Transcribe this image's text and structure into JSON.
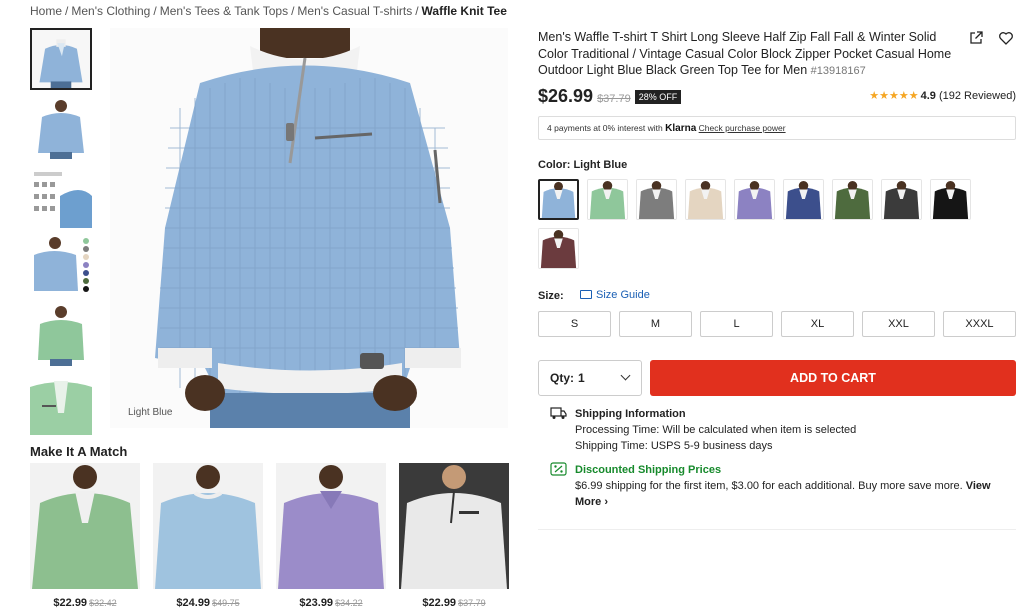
{
  "breadcrumb": {
    "items": [
      "Home",
      "Men's Clothing",
      "Men's Tees & Tank Tops",
      "Men's Casual T-shirts"
    ],
    "current": "Waffle Knit Tee"
  },
  "gallery": {
    "caption": "Light Blue",
    "thumbnails": [
      "light-blue-front",
      "light-blue-back",
      "waffle-detail-chart",
      "light-blue-color-options",
      "green-front",
      "green-closeup"
    ]
  },
  "match": {
    "title": "Make It A Match",
    "items": [
      {
        "price": "$22.99",
        "was": "$32.42",
        "color": "#8dbf8f"
      },
      {
        "price": "$24.99",
        "was": "$49.75",
        "color": "#9fc3df"
      },
      {
        "price": "$23.99",
        "was": "$34.22",
        "color": "#9b8cc9"
      },
      {
        "price": "$22.99",
        "was": "$37.79",
        "color": "#e9e9e9"
      }
    ]
  },
  "product": {
    "title": "Men's Waffle T-shirt T Shirt Long Sleeve Half Zip Fall Fall & Winter Solid Color Traditional / Vintage Casual Color Block Zipper Pocket Casual Home Outdoor Light Blue Black Green Top Tee for Men",
    "sku": "#13918167",
    "price": "$26.99",
    "was_price": "$37.79",
    "discount": "28% OFF",
    "stars": "★★★★★",
    "rating": "4.9",
    "reviews": "(192 Reviewed)"
  },
  "klarna": {
    "text": "4 payments at 0% interest with",
    "brand": "Klarna",
    "link": "Check purchase power"
  },
  "color": {
    "label": "Color: Light Blue",
    "swatches": [
      {
        "name": "Light Blue",
        "hex": "#8fb3d9"
      },
      {
        "name": "Green",
        "hex": "#8fc79b"
      },
      {
        "name": "Gray",
        "hex": "#7d7d7d"
      },
      {
        "name": "Beige",
        "hex": "#e4d5c1"
      },
      {
        "name": "Purple",
        "hex": "#8c82c2"
      },
      {
        "name": "Navy",
        "hex": "#3c4f8c"
      },
      {
        "name": "Army Green",
        "hex": "#4e6b3e"
      },
      {
        "name": "Dark Gray",
        "hex": "#3b3b3b"
      },
      {
        "name": "Black",
        "hex": "#151515"
      },
      {
        "name": "Burgundy",
        "hex": "#6b3b3e"
      }
    ]
  },
  "size": {
    "label": "Size:",
    "guide": "Size Guide",
    "options": [
      "S",
      "M",
      "L",
      "XL",
      "XXL",
      "XXXL"
    ]
  },
  "cart": {
    "qty_label": "Qty:",
    "qty_value": "1",
    "add_label": "ADD TO CART"
  },
  "shipping": {
    "title": "Shipping Information",
    "processing": "Processing Time: Will be calculated when item is selected",
    "time": "Shipping Time: USPS 5-9 business days"
  },
  "discount_shipping": {
    "title": "Discounted Shipping Prices",
    "text": "$6.99 shipping for the first item, $3.00 for each additional. Buy more save more.",
    "view": "View More",
    "chevron": "›"
  },
  "accent": "#e1301e"
}
